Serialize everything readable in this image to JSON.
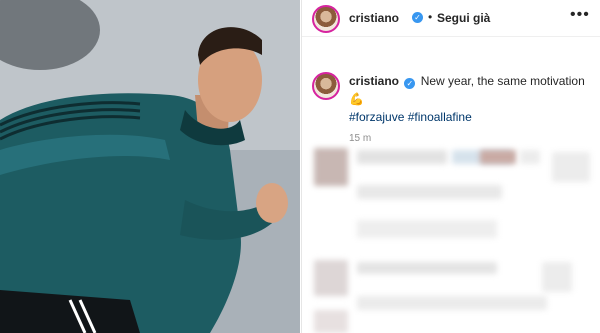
{
  "post": {
    "username": "cristiano",
    "follow_status": "Segui già",
    "caption_text": "New year, the same motivation",
    "caption_emoji": "💪",
    "hashtags": [
      "#forzajuve",
      "#finoallafine"
    ],
    "time_ago": "15 m"
  },
  "icons": {
    "verified": "verified-badge-icon",
    "more": "more-options-icon"
  },
  "colors": {
    "verified": "#3897f0",
    "hashtag": "#00376b",
    "text": "#262626",
    "muted": "#8e8e8e"
  }
}
